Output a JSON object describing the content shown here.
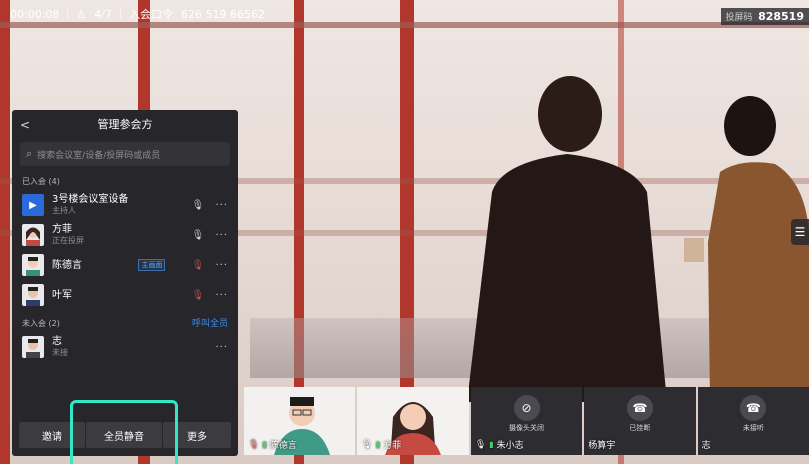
{
  "meeting": {
    "duration": "00:00:08",
    "participant_count": "4/7",
    "join_code_label": "入会口令",
    "join_code": "626 519 66562",
    "share_code_label": "投屏码",
    "share_code": "828519"
  },
  "panel": {
    "back_label": "<",
    "title": "管理参会方",
    "search_placeholder": "搜索会议室/设备/投屏码或成员",
    "joined_label": "已入会 (4)",
    "joined": [
      {
        "name": "3号楼会议室设备",
        "sub": "主持人",
        "mic": "on"
      },
      {
        "name": "方菲",
        "sub": "正在投屏",
        "mic": "on"
      },
      {
        "name": "陈德言",
        "sub": "",
        "tag": "主画面",
        "mic": "off"
      },
      {
        "name": "叶军",
        "sub": "",
        "mic": "off"
      }
    ],
    "not_joined_label": "未入会 (2)",
    "call_all": "呼叫全员",
    "not_joined": [
      {
        "name": "志",
        "sub": "未接"
      }
    ],
    "footer": {
      "invite": "邀请",
      "mute_all": "全员静音",
      "more": "更多"
    }
  },
  "thumbnails": [
    {
      "name": "陈德言",
      "kind": "video"
    },
    {
      "name": "方菲",
      "kind": "video"
    },
    {
      "name": "朱小志",
      "kind": "camera-off",
      "status": "摄像头关闭"
    },
    {
      "name": "杨算宇",
      "kind": "hung-up",
      "status": "已挂断"
    },
    {
      "name": "志",
      "kind": "no-answer",
      "status": "未接听"
    }
  ],
  "colors": {
    "accent_blue": "#3c8df0",
    "highlight": "#33e6c7",
    "panel_bg": "#26262b"
  }
}
